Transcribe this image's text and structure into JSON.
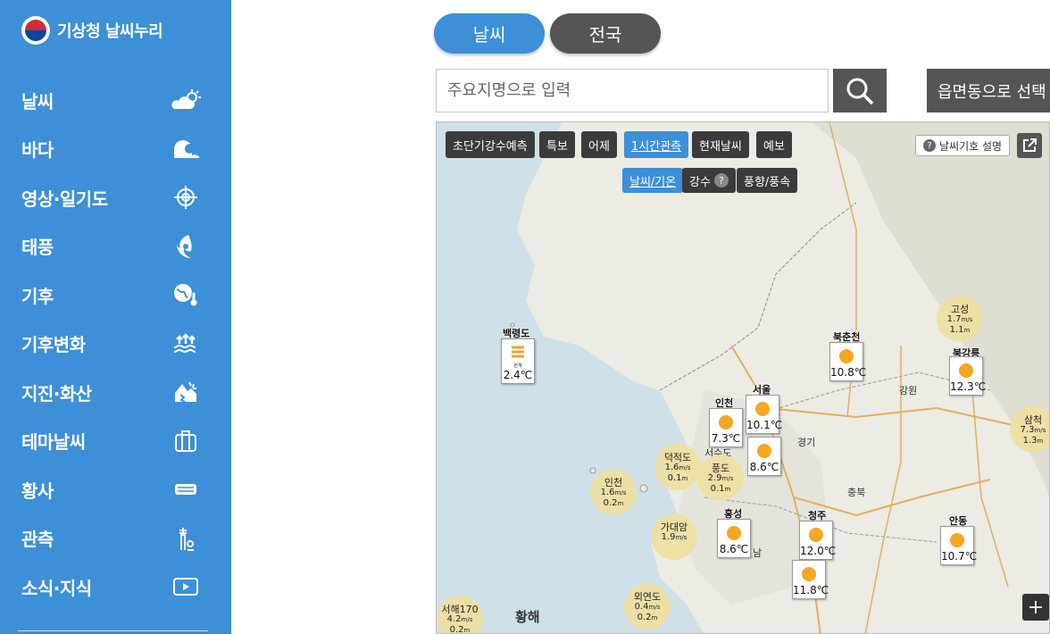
{
  "app": {
    "brand_name": "기상청 날씨누리"
  },
  "sidebar": {
    "items": [
      {
        "label": "날씨",
        "icon": "cloud-sun-icon"
      },
      {
        "label": "바다",
        "icon": "wave-icon"
      },
      {
        "label": "영상·일기도",
        "icon": "satellite-icon"
      },
      {
        "label": "태풍",
        "icon": "typhoon-icon"
      },
      {
        "label": "기후",
        "icon": "globe-thermometer-icon"
      },
      {
        "label": "기후변화",
        "icon": "rising-sea-icon"
      },
      {
        "label": "지진·화산",
        "icon": "earthquake-icon"
      },
      {
        "label": "테마날씨",
        "icon": "suitcase-icon"
      },
      {
        "label": "황사",
        "icon": "dust-mask-icon"
      },
      {
        "label": "관측",
        "icon": "observation-tower-icon"
      },
      {
        "label": "소식·지식",
        "icon": "video-icon"
      }
    ]
  },
  "tabs": [
    {
      "label": "날씨"
    },
    {
      "label": "전국"
    }
  ],
  "search": {
    "placeholder": "주요지명으로 입력",
    "region_select": "읍면동으로 선택"
  },
  "map": {
    "layer_buttons": [
      "초단기강수예측",
      "특보",
      "어제",
      "1시간관측",
      "현재날씨",
      "예보"
    ],
    "active_layer": "1시간관측",
    "sub_buttons": [
      "날씨/기온",
      "강수",
      "풍향/풍속"
    ],
    "active_sub": "날씨/기온",
    "legend_label": "날씨기호 설명",
    "sea_label": "황해",
    "provinces": [
      "강원",
      "경기",
      "충북",
      "남"
    ],
    "stations": [
      {
        "name": "백령도",
        "temp": "2.4℃",
        "weather": "fog",
        "note": "안개"
      },
      {
        "name": "북춘천",
        "temp": "10.8℃",
        "weather": "sunny"
      },
      {
        "name": "북강릉",
        "temp": "12.3℃",
        "weather": "sunny"
      },
      {
        "name": "인천",
        "temp": "7.3℃",
        "weather": "sunny"
      },
      {
        "name": "서울",
        "temp": "10.1℃",
        "weather": "sunny"
      },
      {
        "name": "",
        "temp": "8.6℃",
        "weather": "sunny"
      },
      {
        "name": "홍성",
        "temp": "8.6℃",
        "weather": "sunny"
      },
      {
        "name": "청주",
        "temp": "12.0℃",
        "weather": "sunny"
      },
      {
        "name": "",
        "temp": "11.8℃",
        "weather": "sunny"
      },
      {
        "name": "안동",
        "temp": "10.7℃",
        "weather": "sunny"
      }
    ],
    "buoys": [
      {
        "name": "고성",
        "wind": "1.7",
        "wave": "1.1"
      },
      {
        "name": "삼척",
        "wind": "7.3",
        "wave": "1.3"
      },
      {
        "name": "덕적도",
        "wind": "1.6",
        "wave": "0.1"
      },
      {
        "name": "서수도",
        "wind": "",
        "wave": ""
      },
      {
        "name": "풍도",
        "wind": "2.9",
        "wave": "0.1"
      },
      {
        "name": "인천",
        "wind": "1.6",
        "wave": "0.2"
      },
      {
        "name": "가대암",
        "wind": "1.9",
        "wave": ""
      },
      {
        "name": "외연도",
        "wind": "0.4",
        "wave": "0.2"
      },
      {
        "name": "서해170",
        "wind": "4.2",
        "wave": "0.2"
      }
    ],
    "units": {
      "wind": "m/s",
      "wave": "m"
    },
    "zoom_in": "+"
  },
  "colors": {
    "sidebar": "#3d8fd8",
    "active_tab": "#3d8fd8",
    "inactive_tab": "#555555",
    "sun": "#f5a623"
  }
}
